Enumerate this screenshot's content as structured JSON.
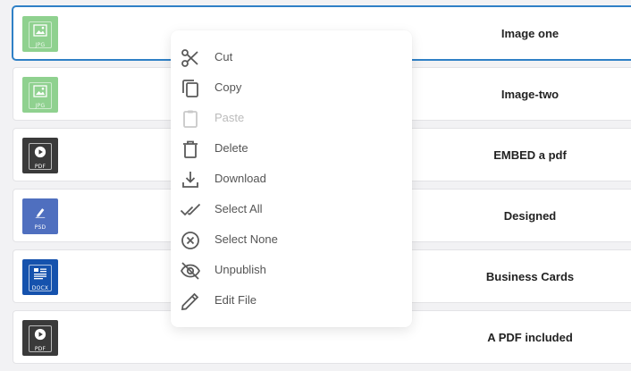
{
  "files": [
    {
      "title": "Image one",
      "ext": "JPG",
      "kind": "image",
      "bg": "#8fd18f",
      "selected": true
    },
    {
      "title": "Image-two",
      "ext": "JPG",
      "kind": "image",
      "bg": "#8fd18f",
      "selected": false
    },
    {
      "title": "EMBED a pdf",
      "ext": "PDF",
      "kind": "video",
      "bg": "#3a3a3a",
      "selected": false
    },
    {
      "title": "Designed",
      "ext": "PSD",
      "kind": "psd",
      "bg": "#4f6fbf",
      "selected": false
    },
    {
      "title": "Business Cards",
      "ext": "DOCX",
      "kind": "doc",
      "bg": "#1552ad",
      "selected": false
    },
    {
      "title": "A PDF included",
      "ext": "PDF",
      "kind": "video",
      "bg": "#3a3a3a",
      "selected": false
    }
  ],
  "menu": {
    "items": [
      {
        "label": "Cut",
        "icon": "scissors-icon",
        "disabled": false
      },
      {
        "label": "Copy",
        "icon": "copy-icon",
        "disabled": false
      },
      {
        "label": "Paste",
        "icon": "clipboard-icon",
        "disabled": true
      },
      {
        "label": "Delete",
        "icon": "trash-icon",
        "disabled": false
      },
      {
        "label": "Download",
        "icon": "download-icon",
        "disabled": false
      },
      {
        "label": "Select All",
        "icon": "double-check-icon",
        "disabled": false
      },
      {
        "label": "Select None",
        "icon": "circle-x-icon",
        "disabled": false
      },
      {
        "label": "Unpublish",
        "icon": "eye-off-icon",
        "disabled": false
      },
      {
        "label": "Edit File",
        "icon": "pencil-icon",
        "disabled": false
      }
    ]
  }
}
